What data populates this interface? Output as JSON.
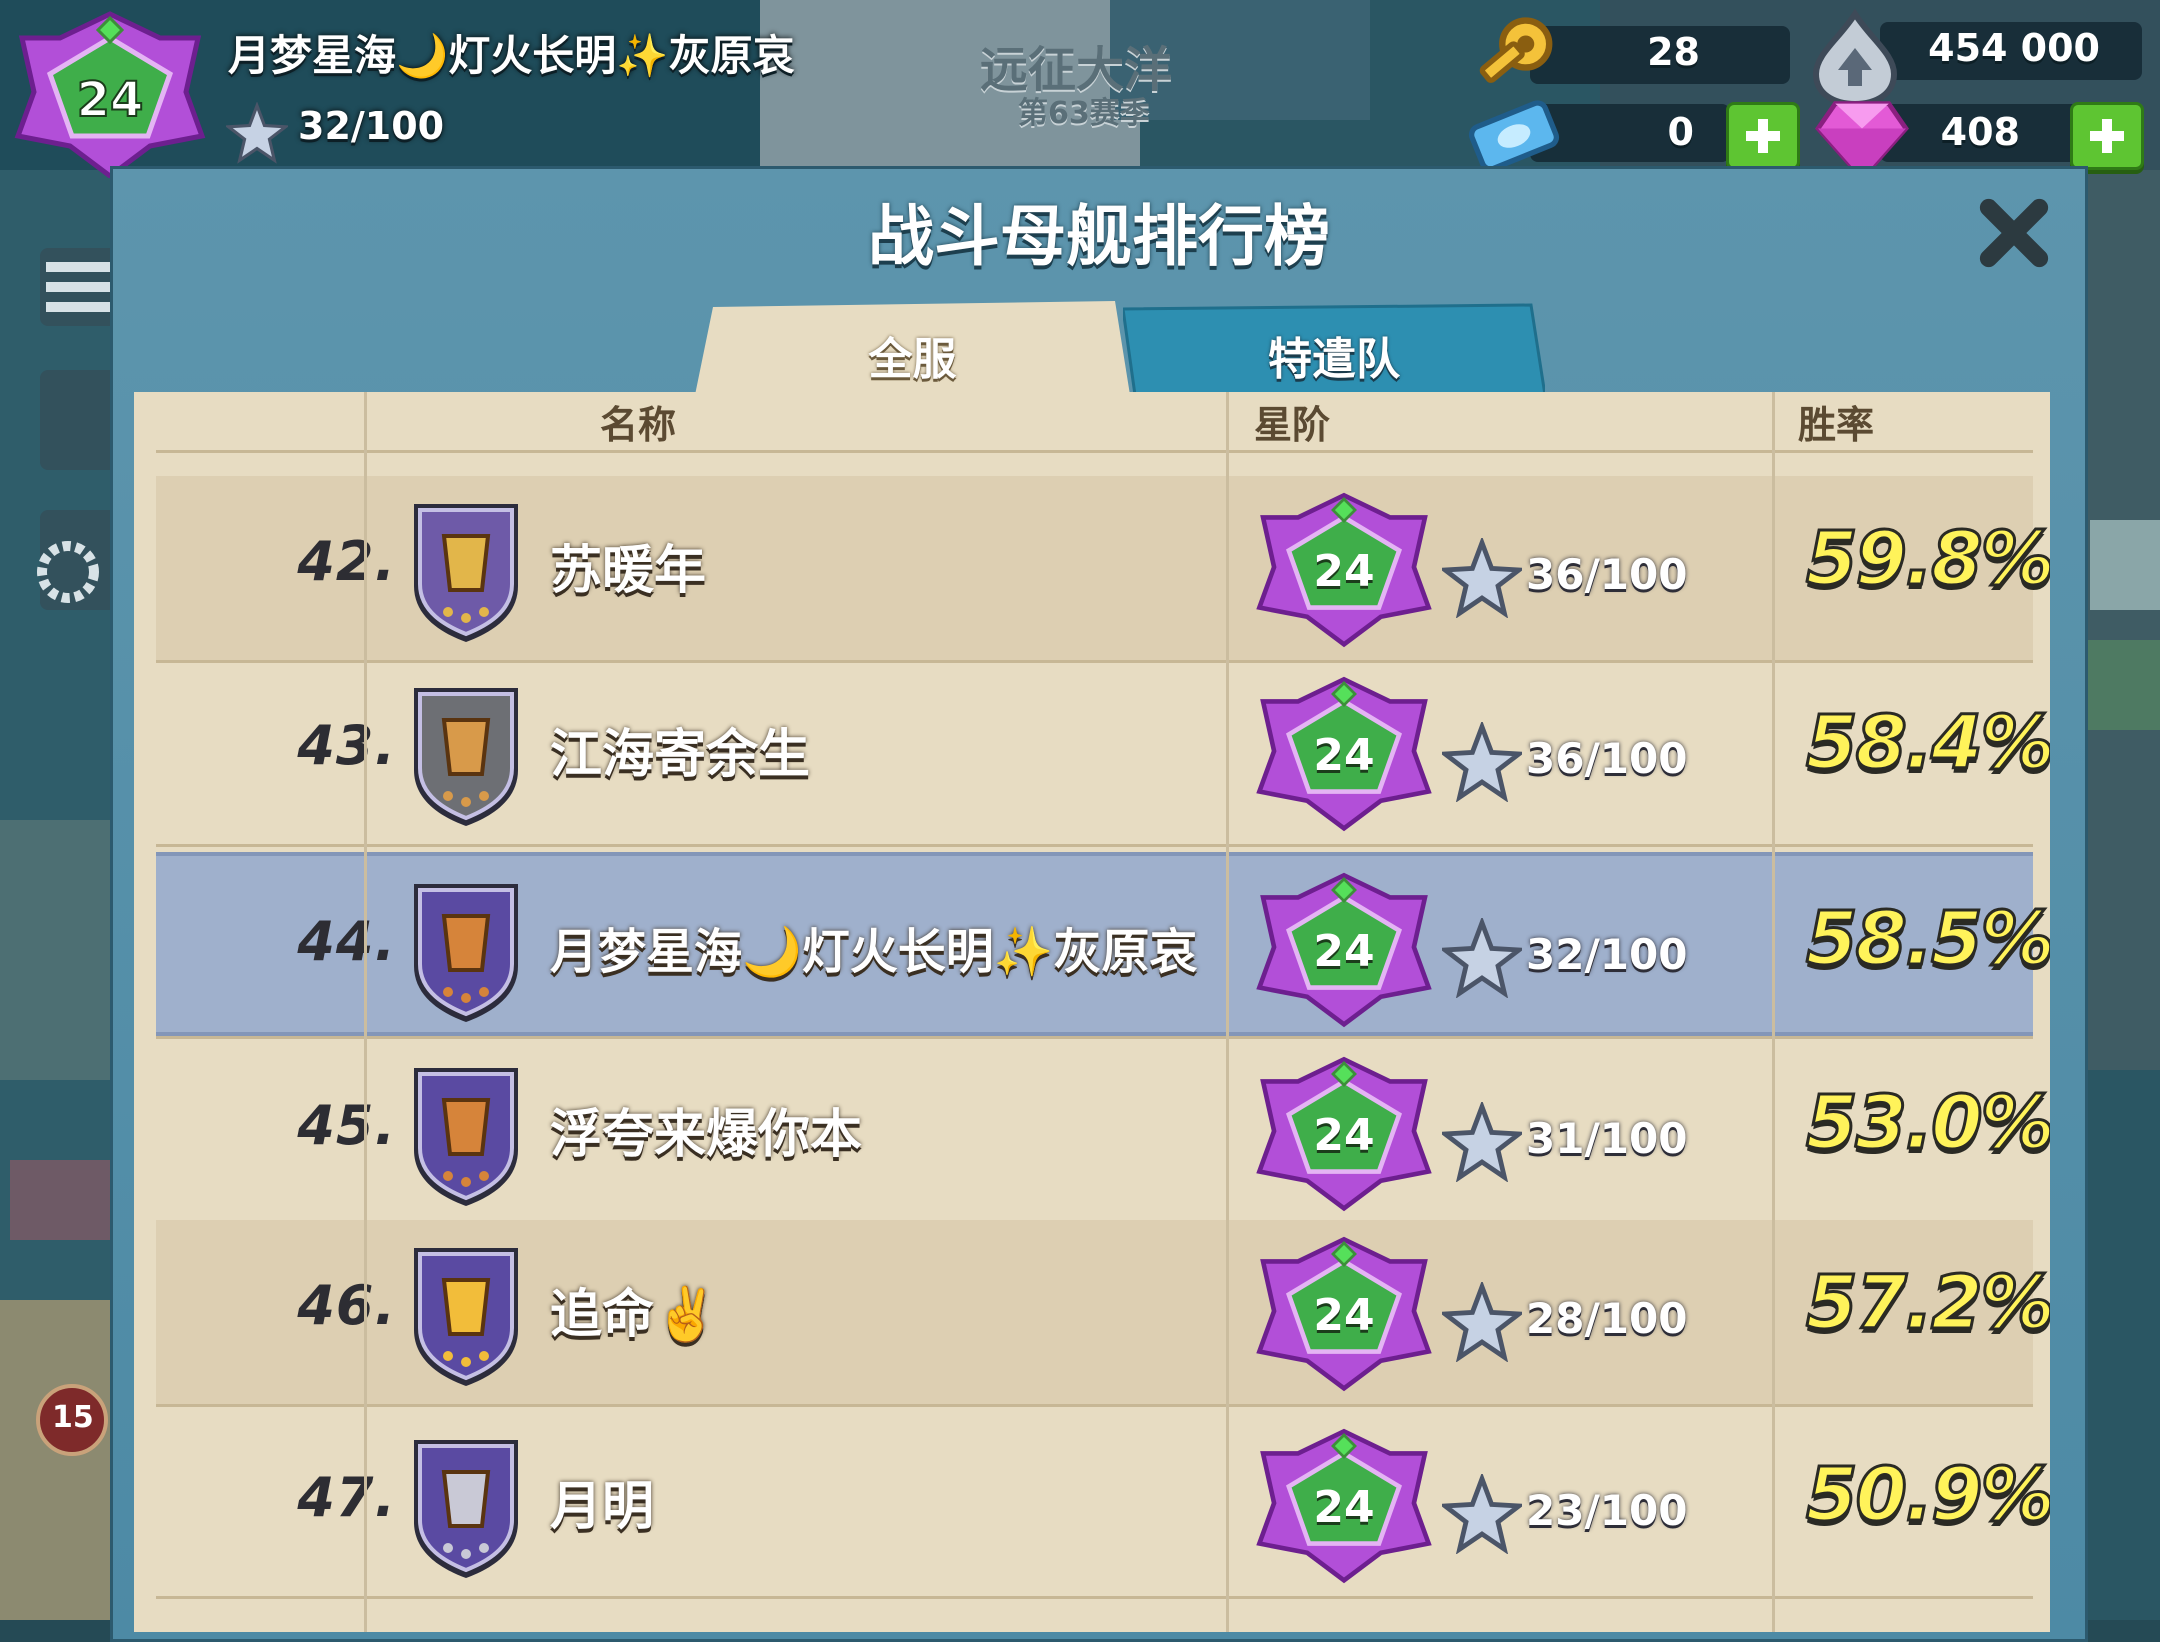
{
  "hud": {
    "player_name": "月梦星海🌙灯火长明✨灰原哀",
    "level": "24",
    "stars": "32/100",
    "keys": "28",
    "tickets": "0",
    "intel": "454 000",
    "gems": "408",
    "bg_title": "远征大洋",
    "bg_season": "第63赛季",
    "side_badge": "15"
  },
  "panel": {
    "title": "战斗母舰排行榜",
    "tabs": [
      {
        "label": "全服",
        "active": true
      },
      {
        "label": "特遣队",
        "active": false
      }
    ],
    "columns": {
      "name": "名称",
      "rank_tier": "星阶",
      "win_rate": "胜率"
    }
  },
  "leaderboard": [
    {
      "rank": "42.",
      "name": "苏暖年",
      "level": "24",
      "stars": "36/100",
      "win_rate": "59.8%",
      "emblem": "gold-winged-shield-icon",
      "highlight": false
    },
    {
      "rank": "43.",
      "name": "江海寄余生",
      "level": "24",
      "stars": "36/100",
      "win_rate": "58.4%",
      "emblem": "grey-dragon-shield-icon",
      "highlight": false
    },
    {
      "rank": "44.",
      "name": "月梦星海🌙灯火长明✨灰原哀",
      "level": "24",
      "stars": "32/100",
      "win_rate": "58.5%",
      "emblem": "purple-fist-shield-icon",
      "highlight": true
    },
    {
      "rank": "45.",
      "name": "浮夸来爆你本",
      "level": "24",
      "stars": "31/100",
      "win_rate": "53.0%",
      "emblem": "purple-fist-shield-icon",
      "highlight": false
    },
    {
      "rank": "46.",
      "name": "追命✌️",
      "level": "24",
      "stars": "28/100",
      "win_rate": "57.2%",
      "emblem": "gold-fist-shield-icon",
      "highlight": false
    },
    {
      "rank": "47.",
      "name": "月明",
      "level": "24",
      "stars": "23/100",
      "win_rate": "50.9%",
      "emblem": "wolf-shield-icon",
      "highlight": false
    }
  ],
  "colors": {
    "panel": "#4d8aa5",
    "parchment": "#e7dcc2",
    "highlight_row": "#9fb0cc",
    "win_rate_text": "#fff35a",
    "badge_purple": "#b24fd8",
    "plus_green": "#5ec532"
  }
}
